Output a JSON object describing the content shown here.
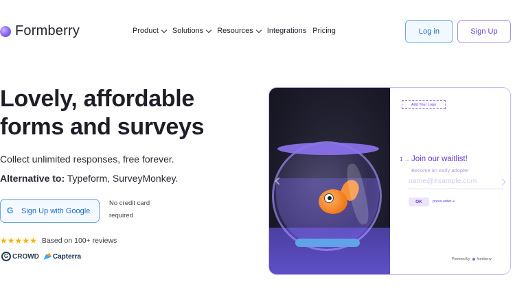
{
  "brand": {
    "name": "Formberry"
  },
  "nav": {
    "items": [
      {
        "label": "Product",
        "dropdown": true
      },
      {
        "label": "Solutions",
        "dropdown": true
      },
      {
        "label": "Resources",
        "dropdown": true
      },
      {
        "label": "Integrations",
        "dropdown": false
      },
      {
        "label": "Pricing",
        "dropdown": false
      }
    ],
    "login_label": "Log in",
    "signup_label": "Sign Up"
  },
  "hero": {
    "headline_line1": "Lovely, affordable",
    "headline_line2": "forms and surveys",
    "subtitle": "Collect unlimited responses, free forever.",
    "alternative_prefix": "Alternative to:",
    "alternative_list": "Typeform, SurveyMonkey.",
    "google_button_label": "Sign Up with Google",
    "no_credit_line1": "No credit card",
    "no_credit_line2": "required",
    "rating_stars": 5,
    "reviews_text": "Based on 100+ reviews",
    "badge_g2": "CROWD",
    "badge_capterra": "Capterra"
  },
  "preview": {
    "logo_placeholder": "Add Your Logo",
    "question_number": "1 →",
    "question_title": "Join our waitlist!",
    "question_description": "Become an early adopter",
    "input_placeholder": "name@example.com",
    "ok_label": "OK",
    "press_enter": "press enter ↵",
    "powered_by": "Powered by",
    "powered_brand": "formberry"
  },
  "colors": {
    "accent_purple": "#6a3ad1",
    "accent_blue": "#1a6fc8",
    "star": "#f5b400"
  }
}
